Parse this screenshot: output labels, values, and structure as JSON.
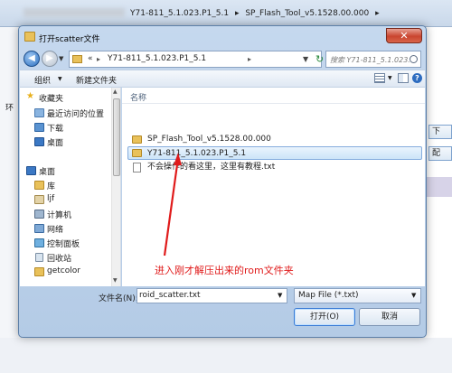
{
  "background": {
    "path": [
      "Y71-811_5.1.023.P1_5.1",
      "▸",
      "SP_Flash_Tool_v5.1528.00.000",
      "▸"
    ],
    "left_label": "环",
    "right_items": [
      "下",
      "配"
    ]
  },
  "dialog": {
    "title": "打开scatter文件",
    "close_label": "✕",
    "address": {
      "chevron": "«",
      "segment": "Y71-811_5.1.023.P1_5.1",
      "refresh": "↻"
    },
    "search": {
      "placeholder": "搜索 Y71-811_5.1.023.P1_5.1"
    },
    "toolbar": {
      "organize": "组织",
      "new_folder": "新建文件夹",
      "help": "?"
    },
    "nav_pane": {
      "favorites": "收藏夹",
      "recent": "最近访问的位置",
      "downloads": "下载",
      "desktop_fav": "桌面",
      "desktop": "桌面",
      "libraries": "库",
      "user": "ljf",
      "computer": "计算机",
      "network": "网络",
      "control_panel": "控制面板",
      "recycle_bin": "回收站",
      "getcolor": "getcolor"
    },
    "file_list": {
      "column_name": "名称",
      "items": [
        {
          "name": "SP_Flash_Tool_v5.1528.00.000"
        },
        {
          "name": "Y71-811_5.1.023.P1_5.1"
        },
        {
          "name": "不会操作的看这里，这里有教程.txt"
        }
      ]
    },
    "annotation": "进入刚才解压出来的rom文件夹",
    "filename_label": "文件名(N):",
    "filename_value": "roid_scatter.txt",
    "filetype_value": "Map File (*.txt)",
    "open_button": "打开(O)",
    "cancel_button": "取消"
  }
}
